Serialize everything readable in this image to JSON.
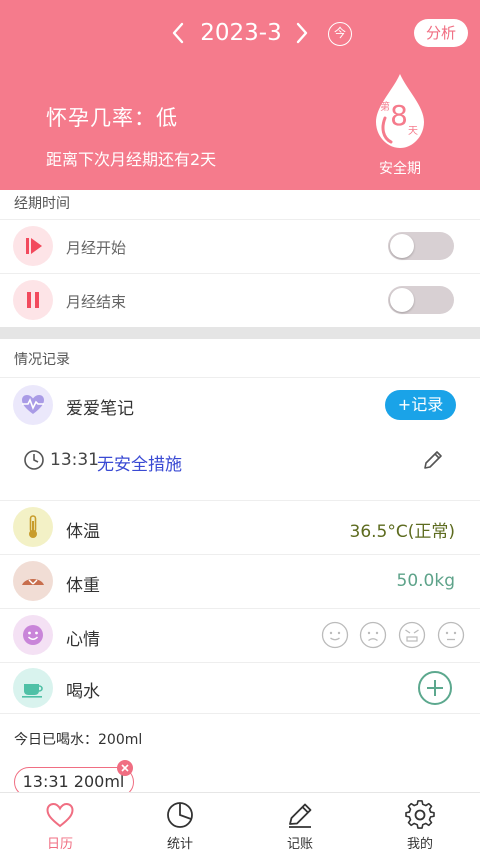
{
  "header": {
    "month": "2023-3",
    "today_label": "今",
    "analyze_label": "分析",
    "pregnancy_rate": "怀孕几率：低",
    "countdown": "距离下次月经期还有2天",
    "day_prefix": "第",
    "day_number": "8",
    "day_suffix": "天",
    "phase": "安全期",
    "accent_color": "#f57b8c"
  },
  "period": {
    "title": "经期时间",
    "start_label": "月经开始",
    "end_label": "月经结束",
    "start_on": false,
    "end_on": false
  },
  "records": {
    "title": "情况记录",
    "love_label": "爱爱笔记",
    "record_button": "+记录",
    "entry_time": "13:31",
    "entry_text": "无安全措施",
    "temp_label": "体温",
    "temp_value": "36.5°C(正常)",
    "weight_label": "体重",
    "weight_value": "50.0kg",
    "mood_label": "心情",
    "water_label": "喝水",
    "water_total": "今日已喝水：200ml",
    "water_entry": "13:31 200ml"
  },
  "tabs": [
    {
      "label": "日历",
      "icon": "heart-icon",
      "active": true
    },
    {
      "label": "统计",
      "icon": "pie-chart-icon",
      "active": false
    },
    {
      "label": "记账",
      "icon": "edit-icon",
      "active": false
    },
    {
      "label": "我的",
      "icon": "gear-icon",
      "active": false
    }
  ]
}
